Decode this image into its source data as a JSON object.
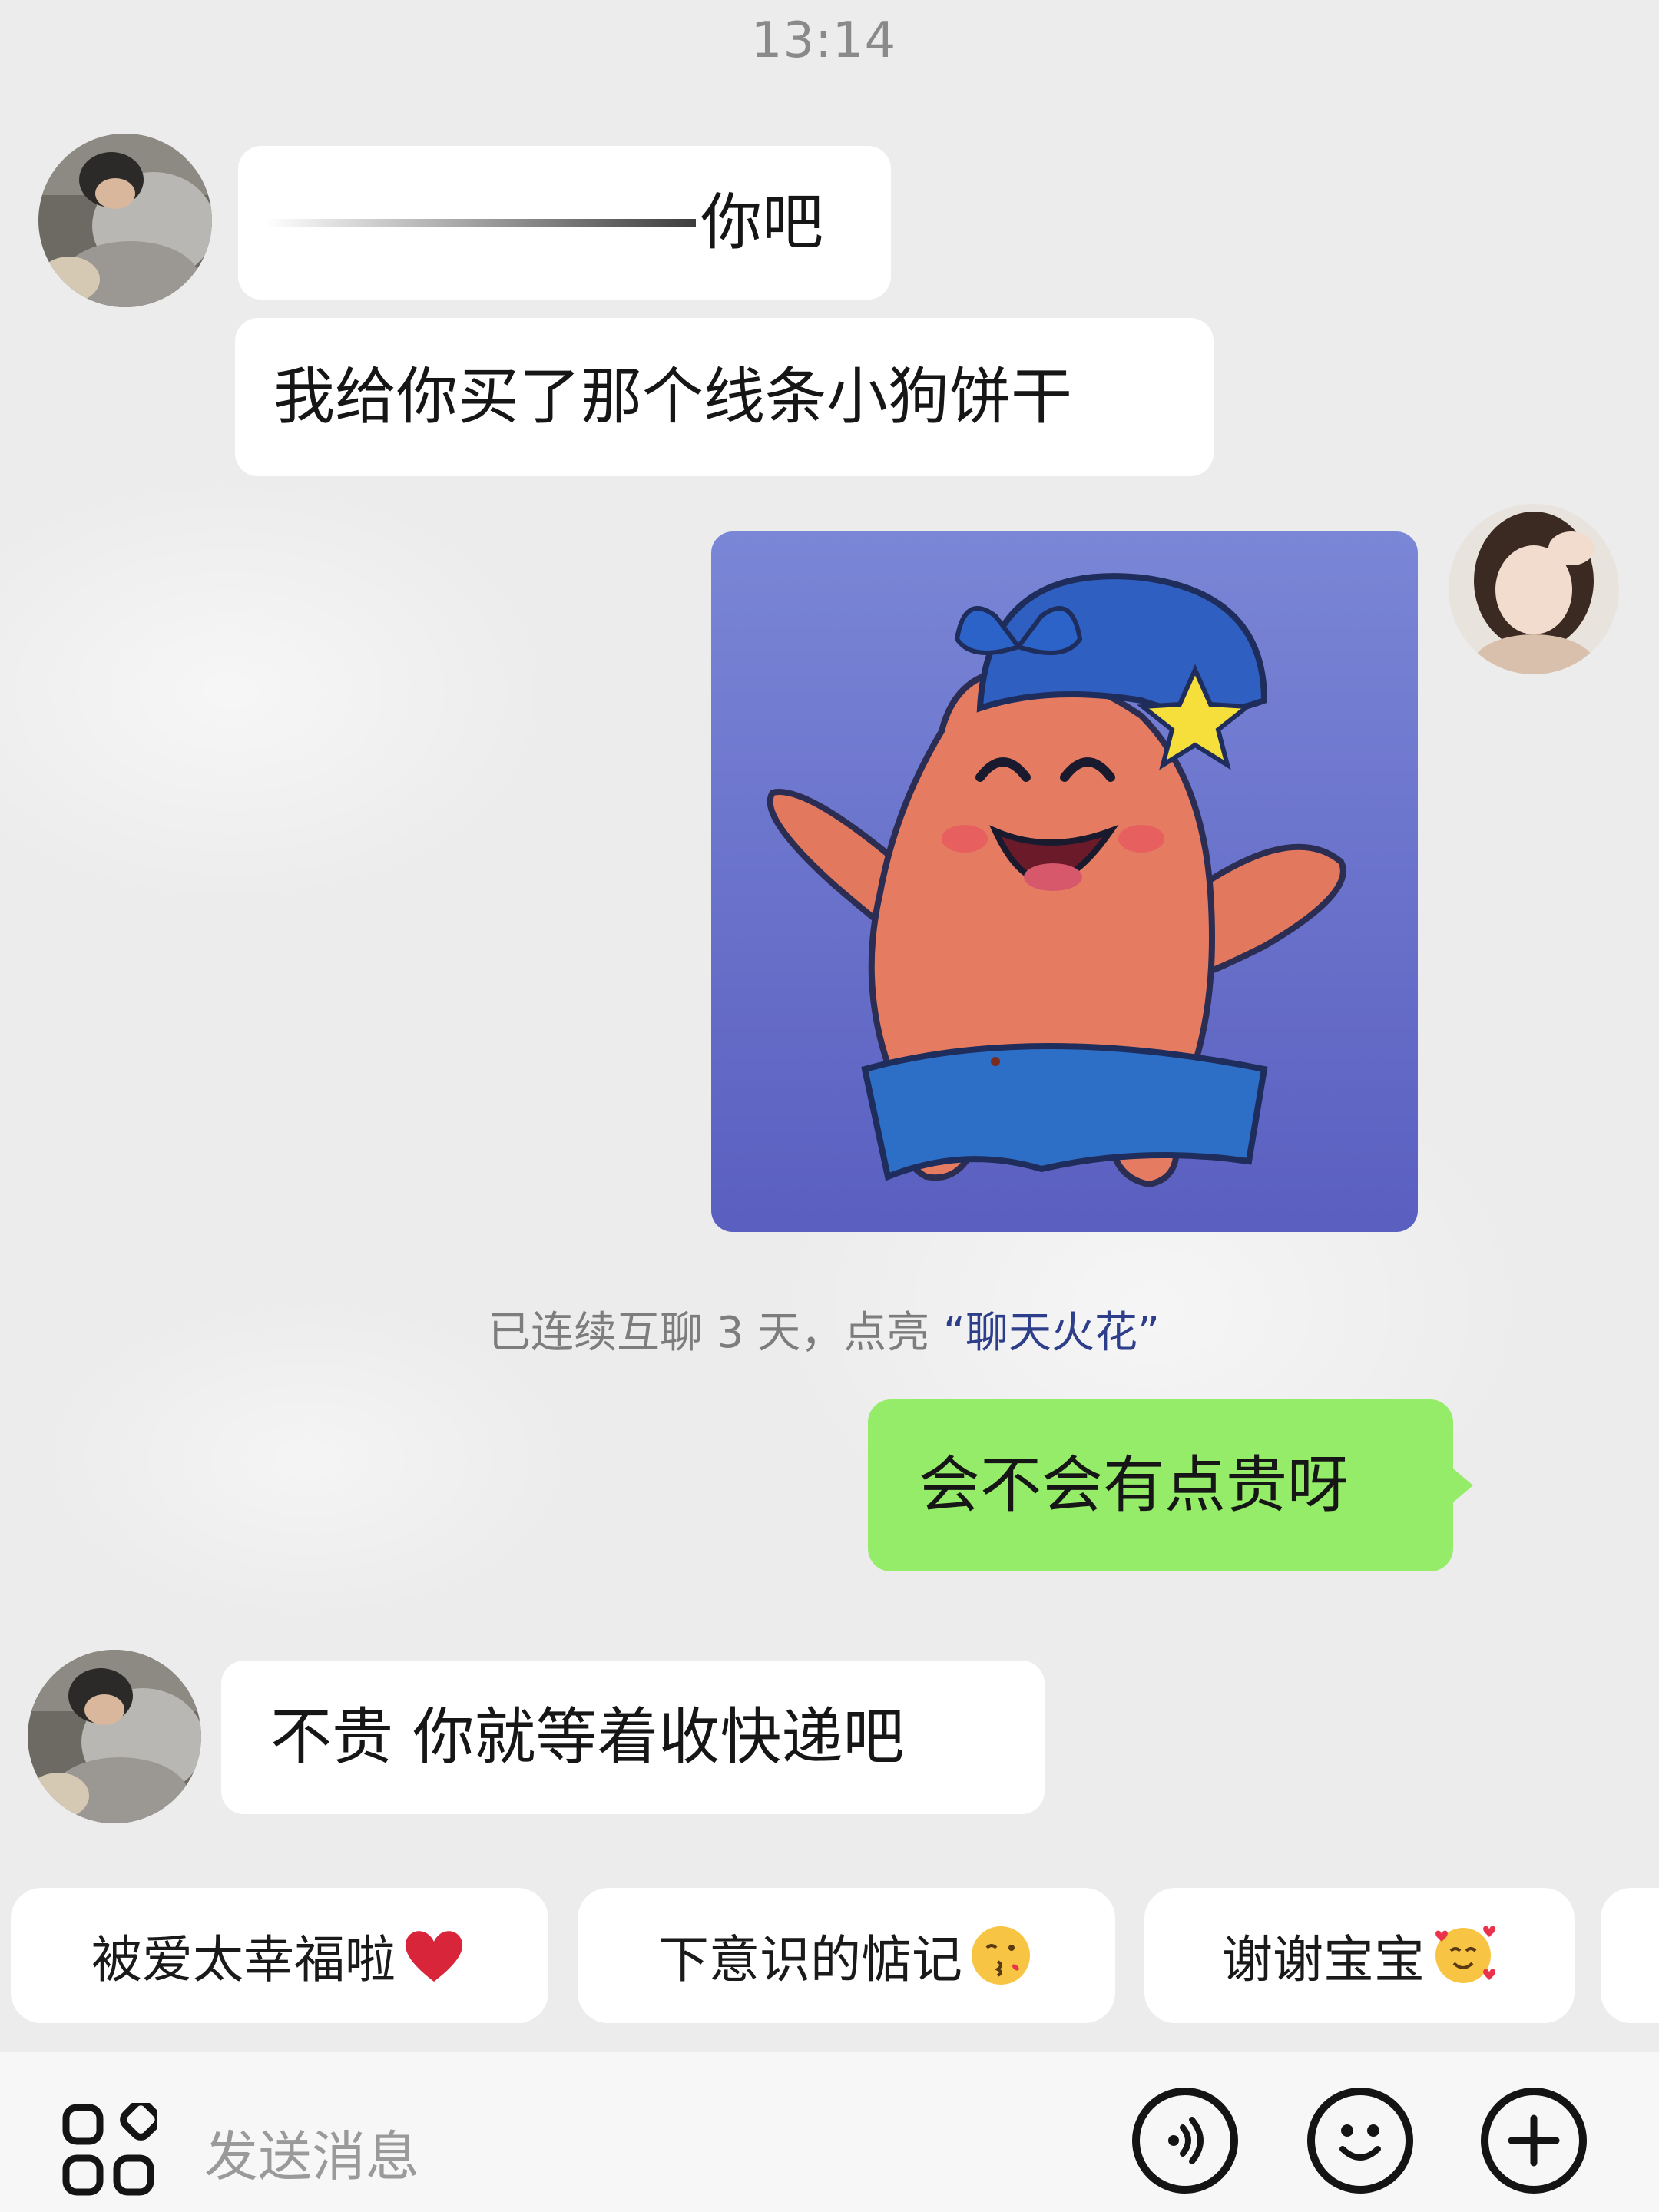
{
  "chat": {
    "timestamp": "13:14",
    "messages": [
      {
        "sender": "other",
        "text": "你吧"
      },
      {
        "sender": "other",
        "text": "我给你买了那个线条小狗饼干"
      },
      {
        "sender": "self",
        "type": "sticker",
        "sticker": "patrick-star-sticker"
      },
      {
        "sender": "other",
        "text": "不贵 你就等着收快递吧"
      }
    ],
    "system_notice": {
      "prefix": "已连续互聊 3 天，点亮 ",
      "highlight": "“聊天火花”"
    },
    "self_reply": "会不会有点贵呀"
  },
  "quick_replies": [
    {
      "label": "被爱太幸福啦",
      "emoji": "red-heart"
    },
    {
      "label": "下意识的惦记",
      "emoji": "kissing-face"
    },
    {
      "label": "谢谢宝宝",
      "emoji": "smiling-face-with-hearts"
    }
  ],
  "input_bar": {
    "placeholder": "发送消息",
    "left_icon": "apps-grid-icon",
    "right_icons": [
      "voice-icon",
      "emoji-icon",
      "plus-icon"
    ]
  },
  "colors": {
    "self_bubble": "#95ec69",
    "other_bubble": "#ffffff",
    "spark_text": "#2d3f8a"
  }
}
